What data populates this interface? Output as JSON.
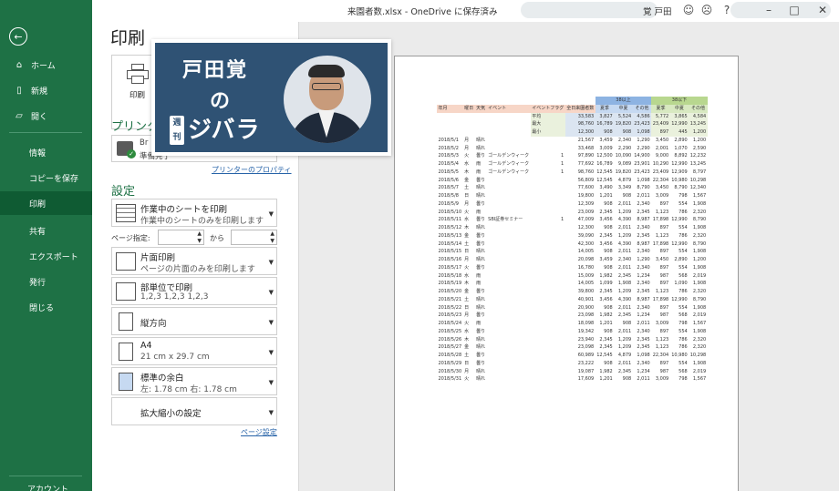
{
  "window": {
    "title": "来園者数.xlsx - OneDrive に保存済み",
    "user": "覚 戸田"
  },
  "nav": {
    "back_icon": "back-arrow-icon",
    "items": [
      {
        "label": "ホーム",
        "icon": "home-icon"
      },
      {
        "label": "新規",
        "icon": "new-document-icon"
      },
      {
        "label": "開く",
        "icon": "folder-open-icon"
      },
      {
        "label": "情報"
      },
      {
        "label": "コピーを保存"
      },
      {
        "label": "印刷",
        "active": true
      },
      {
        "label": "共有"
      },
      {
        "label": "エクスポート"
      },
      {
        "label": "発行"
      },
      {
        "label": "閉じる"
      }
    ],
    "bottom_label": "アカウント"
  },
  "print_pane": {
    "title": "印刷",
    "print_button": "印刷",
    "printer_heading": "プリンター",
    "printer_name": "Br",
    "printer_status": "準備完了",
    "printer_props_link": "プリンターのプロパティ",
    "settings_heading": "設定",
    "options": [
      {
        "line1": "作業中のシートを印刷",
        "line2": "作業中のシートのみを印刷します"
      },
      {
        "line1": "片面印刷",
        "line2": "ページの片面のみを印刷します"
      },
      {
        "line1": "部単位で印刷",
        "line2": "1,2,3    1,2,3    1,2,3"
      },
      {
        "line1": "縦方向",
        "line2": ""
      },
      {
        "line1": "A4",
        "line2": "21 cm x 29.7 cm"
      },
      {
        "line1": "標準の余白",
        "line2": "左:  1.78 cm    右:  1.78 cm"
      },
      {
        "line1": "拡大縮小の設定",
        "line2": ""
      }
    ],
    "pages_label": "ページ指定:",
    "pages_to": "から",
    "page_setup_link": "ページ設定"
  },
  "banner": {
    "name": "戸田覚",
    "no": "の",
    "weekly": "週刊",
    "title": "ジバラ"
  },
  "sheet": {
    "groups": [
      "38以上",
      "38以下"
    ],
    "headers": [
      "年月",
      "曜日",
      "天気",
      "イベント",
      "イベントフラグ",
      "全日来園者数",
      "夏季",
      "中夏",
      "その他",
      "夏季",
      "中夏",
      "その他"
    ],
    "stats": [
      {
        "label": "平均",
        "values": [
          "33,583",
          "3,827",
          "5,524",
          "4,586",
          "5,772",
          "3,865",
          "4,584"
        ]
      },
      {
        "label": "最大",
        "values": [
          "98,760",
          "16,789",
          "19,820",
          "23,423",
          "23,409",
          "12,990",
          "13,245"
        ]
      },
      {
        "label": "最小",
        "values": [
          "12,300",
          "908",
          "908",
          "1,098",
          "897",
          "445",
          "1,200"
        ]
      }
    ],
    "rows": [
      [
        "2018/5/1",
        "月",
        "晴れ",
        "",
        "",
        "21,567",
        "3,459",
        "2,340",
        "1,290",
        "3,450",
        "2,890",
        "1,200"
      ],
      [
        "2018/5/2",
        "月",
        "晴れ",
        "",
        "",
        "33,468",
        "3,009",
        "2,290",
        "2,290",
        "2,001",
        "1,070",
        "2,590"
      ],
      [
        "2018/5/3",
        "火",
        "曇り",
        "ゴールデンウィーク",
        "1",
        "97,890",
        "12,500",
        "10,090",
        "14,900",
        "9,000",
        "8,892",
        "12,232"
      ],
      [
        "2018/5/4",
        "水",
        "雨",
        "ゴールデンウィーク",
        "1",
        "77,692",
        "16,789",
        "9,089",
        "23,901",
        "10,290",
        "12,990",
        "13,245"
      ],
      [
        "2018/5/5",
        "木",
        "雨",
        "ゴールデンウィーク",
        "1",
        "98,760",
        "12,545",
        "19,820",
        "23,423",
        "23,409",
        "12,909",
        "8,797"
      ],
      [
        "2018/5/6",
        "金",
        "曇り",
        "",
        "",
        "56,809",
        "12,545",
        "4,879",
        "1,098",
        "22,304",
        "10,980",
        "10,298"
      ],
      [
        "2018/5/7",
        "土",
        "晴れ",
        "",
        "",
        "77,600",
        "3,490",
        "3,349",
        "8,790",
        "3,450",
        "8,790",
        "12,340"
      ],
      [
        "2018/5/8",
        "日",
        "晴れ",
        "",
        "",
        "19,800",
        "1,201",
        "908",
        "2,011",
        "3,009",
        "798",
        "1,567"
      ],
      [
        "2018/5/9",
        "月",
        "曇り",
        "",
        "",
        "12,309",
        "908",
        "2,011",
        "2,340",
        "897",
        "554",
        "1,908"
      ],
      [
        "2018/5/10",
        "火",
        "雨",
        "",
        "",
        "23,009",
        "2,345",
        "1,209",
        "2,345",
        "1,123",
        "786",
        "2,320"
      ],
      [
        "2018/5/11",
        "水",
        "曇り",
        "SBI証券セミナー",
        "1",
        "47,009",
        "3,456",
        "4,390",
        "8,987",
        "17,898",
        "12,990",
        "8,790"
      ],
      [
        "2018/5/12",
        "木",
        "晴れ",
        "",
        "",
        "12,300",
        "908",
        "2,011",
        "2,340",
        "897",
        "554",
        "1,908"
      ],
      [
        "2018/5/13",
        "金",
        "曇り",
        "",
        "",
        "39,090",
        "2,345",
        "1,209",
        "2,345",
        "1,123",
        "786",
        "2,320"
      ],
      [
        "2018/5/14",
        "土",
        "曇り",
        "",
        "",
        "42,300",
        "3,456",
        "4,390",
        "8,987",
        "17,898",
        "12,990",
        "8,790"
      ],
      [
        "2018/5/15",
        "日",
        "晴れ",
        "",
        "",
        "14,005",
        "908",
        "2,011",
        "2,340",
        "897",
        "554",
        "1,908"
      ],
      [
        "2018/5/16",
        "月",
        "晴れ",
        "",
        "",
        "20,098",
        "3,459",
        "2,340",
        "1,290",
        "3,450",
        "2,890",
        "1,200"
      ],
      [
        "2018/5/17",
        "火",
        "曇り",
        "",
        "",
        "16,780",
        "908",
        "2,011",
        "2,340",
        "897",
        "554",
        "1,908"
      ],
      [
        "2018/5/18",
        "水",
        "雨",
        "",
        "",
        "15,009",
        "1,982",
        "2,345",
        "1,234",
        "987",
        "568",
        "2,019"
      ],
      [
        "2018/5/19",
        "木",
        "雨",
        "",
        "",
        "14,005",
        "1,099",
        "1,908",
        "2,340",
        "897",
        "1,090",
        "1,908"
      ],
      [
        "2018/5/20",
        "金",
        "曇り",
        "",
        "",
        "39,800",
        "2,345",
        "1,209",
        "2,345",
        "1,123",
        "786",
        "2,320"
      ],
      [
        "2018/5/21",
        "土",
        "晴れ",
        "",
        "",
        "40,901",
        "3,456",
        "4,390",
        "8,987",
        "17,898",
        "12,990",
        "8,790"
      ],
      [
        "2018/5/22",
        "日",
        "晴れ",
        "",
        "",
        "20,900",
        "908",
        "2,011",
        "2,340",
        "897",
        "554",
        "1,908"
      ],
      [
        "2018/5/23",
        "月",
        "曇り",
        "",
        "",
        "23,098",
        "1,982",
        "2,345",
        "1,234",
        "987",
        "568",
        "2,019"
      ],
      [
        "2018/5/24",
        "火",
        "雨",
        "",
        "",
        "18,098",
        "1,201",
        "908",
        "2,011",
        "3,009",
        "798",
        "1,567"
      ],
      [
        "2018/5/25",
        "水",
        "曇り",
        "",
        "",
        "19,342",
        "908",
        "2,011",
        "2,340",
        "897",
        "554",
        "1,908"
      ],
      [
        "2018/5/26",
        "木",
        "晴れ",
        "",
        "",
        "23,940",
        "2,345",
        "1,209",
        "2,345",
        "1,123",
        "786",
        "2,320"
      ],
      [
        "2018/5/27",
        "金",
        "晴れ",
        "",
        "",
        "23,098",
        "2,345",
        "1,209",
        "2,345",
        "1,123",
        "786",
        "2,320"
      ],
      [
        "2018/5/28",
        "土",
        "曇り",
        "",
        "",
        "60,989",
        "12,545",
        "4,879",
        "1,098",
        "22,304",
        "10,980",
        "10,298"
      ],
      [
        "2018/5/29",
        "日",
        "曇り",
        "",
        "",
        "23,222",
        "908",
        "2,011",
        "2,340",
        "897",
        "554",
        "1,908"
      ],
      [
        "2018/5/30",
        "月",
        "晴れ",
        "",
        "",
        "19,087",
        "1,982",
        "2,345",
        "1,234",
        "987",
        "568",
        "2,019"
      ],
      [
        "2018/5/31",
        "火",
        "晴れ",
        "",
        "",
        "17,609",
        "1,201",
        "908",
        "2,011",
        "3,009",
        "798",
        "1,567"
      ]
    ]
  },
  "colors": {
    "nav_green": "#1e7145",
    "nav_active": "#0f5b33",
    "banner_blue": "#2f5274",
    "link_blue": "#2763a8"
  }
}
